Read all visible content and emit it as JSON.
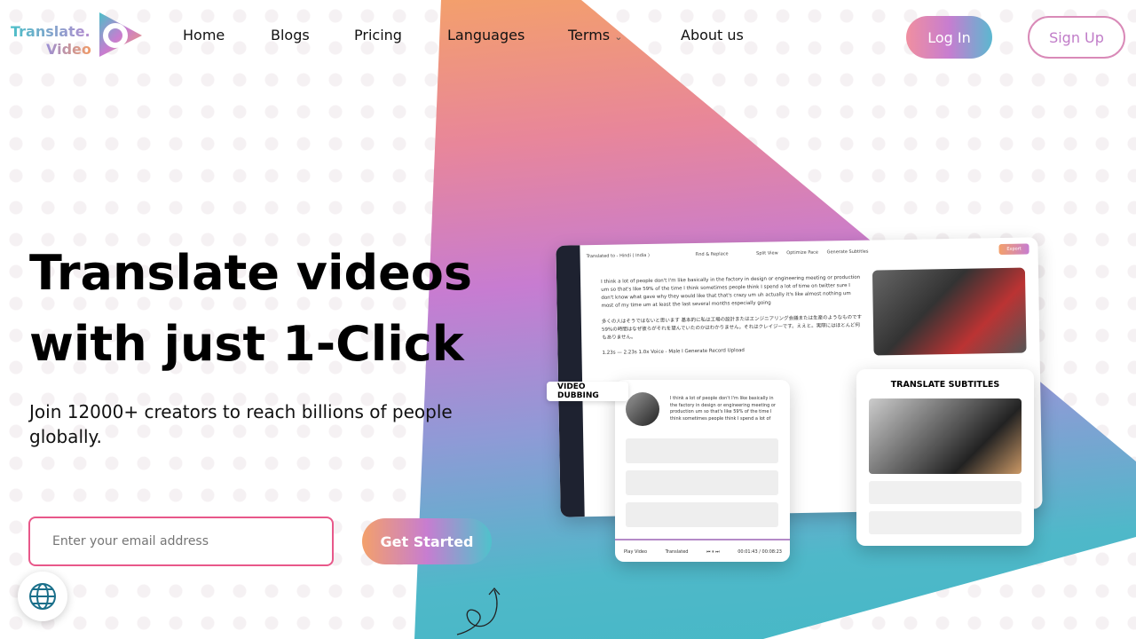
{
  "logo": {
    "line1": "Translate.",
    "line2": "Video"
  },
  "nav": {
    "items": [
      "Home",
      "Blogs",
      "Pricing",
      "Languages",
      "Terms",
      "About us"
    ],
    "login": "Log In",
    "signup": "Sign Up"
  },
  "hero": {
    "title_line1": "Translate videos",
    "title_line2": "with just 1-Click",
    "subtitle": "Join 12000+ creators to reach billions of people globally.",
    "email_placeholder": "Enter your email address",
    "cta": "Get Started"
  },
  "mockup": {
    "translated_to": "Translated to - Hindi ( India )",
    "toolbar": [
      "Find & Replace",
      "Split View",
      "Optimize Pace",
      "Generate Subtitles"
    ],
    "export": "Export",
    "english_text": "I think a lot of people don't I'm like basically in the factory in design or engineering meeting or production um so that's like 59% of the time I think sometimes people think I spend a lot of time on twitter sure I don't know what gave why they would like that that's crazy um uh actually it's like almost nothing um most of my time um at least the last several months especially going",
    "japanese_text": "多くの人はそうではないと思います 基本的に私は工場の設計またはエンジニアリング会議または生産のようなものです 59%の時間はなぜ彼らがそれを望んでいたのかはわかりません。それはクレイジーです。ええと。実際にはほとんど何もありません。",
    "controls": "1.23s — 2.23s  1.0x  Voice - Male I  Generate  Record  Upload",
    "dubbing_label": "VIDEO DUBBING",
    "dubbing_text": "I think a lot of people don't I'm like basically in the factory in design or engineering meeting or production um so that's like 59% of the time I think sometimes people think I spend a lot of",
    "play_video": "Play Video",
    "translated": "Translated",
    "time": "00:01:43 / 00:08:23",
    "subtitles_label": "TRANSLATE SUBTITLES"
  },
  "colors": {
    "accent_pink": "#e8588a",
    "gradient": [
      "#f6a660",
      "#c77cd1",
      "#4fb8c9"
    ]
  }
}
